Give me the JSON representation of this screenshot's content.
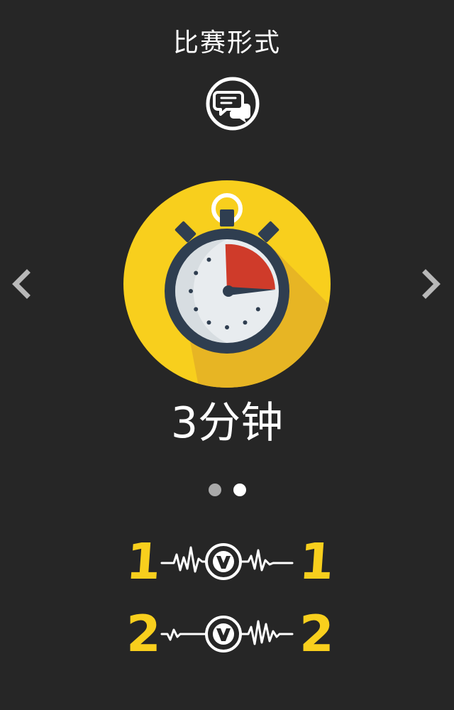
{
  "header": {
    "title": "比赛形式",
    "chat_icon": "chat-bubbles-icon"
  },
  "carousel": {
    "prev_icon": "chevron-left-icon",
    "next_icon": "chevron-right-icon",
    "slide": {
      "icon": "stopwatch-icon",
      "label": "3分钟"
    },
    "page_count": 2,
    "active_page": 2
  },
  "modes": [
    {
      "left": "1",
      "right": "1",
      "icon": "versus-icon"
    },
    {
      "left": "2",
      "right": "2",
      "icon": "versus-icon"
    }
  ],
  "colors": {
    "background": "#262626",
    "accent_yellow": "#f8cf1d",
    "stopwatch_red": "#cf3b2a",
    "stopwatch_navy": "#2f3e50",
    "dot_inactive": "#a9a9a9",
    "dot_active": "#ffffff"
  }
}
